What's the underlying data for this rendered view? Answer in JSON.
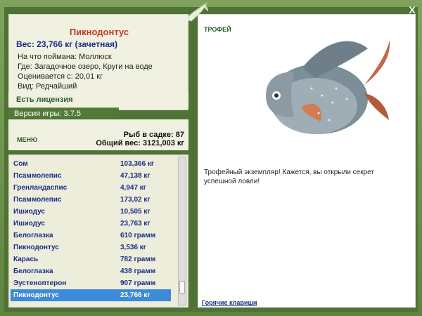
{
  "window": {
    "close_label": "X"
  },
  "fish": {
    "title": "Пикнодонтус",
    "weight": "Вес: 23,766 кг (зачетная)",
    "details": [
      "На что поймана: Моллюск",
      "Где: Загадочное озеро, Круги на воде",
      "Оценивается с: 20,01 кг",
      "Вид: Редчайший"
    ]
  },
  "license": "Есть лицензия",
  "version": "Версия игры: 3.7.5",
  "menu": "МЕНЮ",
  "stats": {
    "fish_count": "Рыб в садке: 87",
    "total_weight": "Общий вес: 3121,003 кг"
  },
  "catch_list": [
    {
      "name": "Сом",
      "weight": "103,366 кг"
    },
    {
      "name": "Псаммолепис",
      "weight": "47,138 кг"
    },
    {
      "name": "Гренландаспис",
      "weight": "4,947 кг"
    },
    {
      "name": "Псаммолепис",
      "weight": "173,02 кг"
    },
    {
      "name": "Ишиодус",
      "weight": "10,505 кг"
    },
    {
      "name": "Ишиодус",
      "weight": "23,763 кг"
    },
    {
      "name": "Белоглазка",
      "weight": "610 грамм"
    },
    {
      "name": "Пикнодонтус",
      "weight": "3,536 кг"
    },
    {
      "name": "Карась",
      "weight": "782 грамм"
    },
    {
      "name": "Белоглазка",
      "weight": "438 грамм"
    },
    {
      "name": "Эустеноптерон",
      "weight": "907 грамм"
    },
    {
      "name": "Пикнодонтус",
      "weight": "23,766 кг"
    }
  ],
  "trophy": {
    "label": "ТРОФЕЙ",
    "text": "Трофейный экземпляр! Кажется, вы открыли секрет успешной ловли!",
    "hotkeys": "Горячие клавиши"
  }
}
